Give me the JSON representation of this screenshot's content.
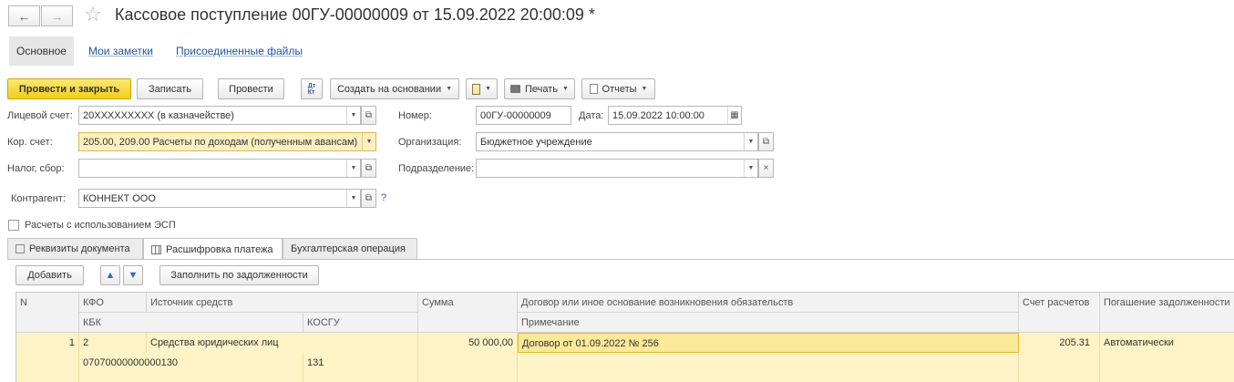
{
  "window": {
    "title": "Кассовое поступление 00ГУ-00000009 от 15.09.2022 20:00:09 *",
    "back_icon": "←",
    "forward_icon": "→",
    "star_icon": "☆"
  },
  "nav": {
    "main": "Основное",
    "notes": "Мои заметки",
    "files": "Присоединенные файлы"
  },
  "toolbar": {
    "post_close": "Провести и закрыть",
    "save": "Записать",
    "post": "Провести",
    "create_based": "Создать на основании",
    "print": "Печать",
    "reports": "Отчеты"
  },
  "form": {
    "account_label": "Лицевой счет:",
    "account_value": "20XXXXXXXXX (в казначействе)",
    "corr_label": "Кор. счет:",
    "corr_value": "205.00, 209.00 Расчеты по доходам (полученным авансам)",
    "tax_label": "Налог, сбор:",
    "tax_value": "",
    "contractor_label": "Контрагент:",
    "contractor_value": "КОННЕКТ ООО",
    "help": "?",
    "number_label": "Номер:",
    "number_value": "00ГУ-00000009",
    "date_label": "Дата:",
    "date_value": "15.09.2022 10:00:00",
    "org_label": "Организация:",
    "org_value": "Бюджетное учреждение",
    "dept_label": "Подразделение:",
    "dept_value": "",
    "esp_label": "Расчеты с использованием ЭСП"
  },
  "tabs": {
    "requisites": "Реквизиты документа",
    "breakdown": "Расшифровка платежа",
    "accounting": "Бухгалтерская операция"
  },
  "table_toolbar": {
    "add": "Добавить",
    "fill": "Заполнить по задолженности"
  },
  "table": {
    "headers": {
      "n": "N",
      "kfo": "КФО",
      "source": "Источник средств",
      "kbk": "КБК",
      "kosgu": "КОСГУ",
      "sum": "Сумма",
      "contract": "Договор или иное основание возникновения обязательств",
      "note": "Примечание",
      "account": "Счет расчетов",
      "repay": "Погашение задолженности"
    },
    "rows": [
      {
        "n": "1",
        "kfo": "2",
        "source": "Средства юридических лиц",
        "kbk": "07070000000000130",
        "kosgu": "131",
        "sum": "50 000,00",
        "contract": "Договор от 01.09.2022 № 256",
        "note": "",
        "account": "205.31",
        "repay": "Автоматически"
      }
    ]
  }
}
